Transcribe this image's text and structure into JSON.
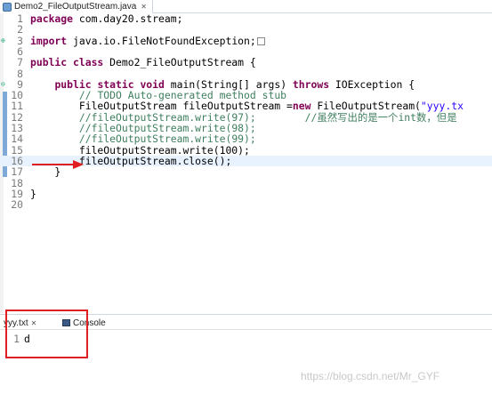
{
  "editor_tab": {
    "title": "Demo2_FileOutputStream.java",
    "close": "✕"
  },
  "lines": [
    {
      "n": "1",
      "parts": [
        [
          "kw",
          "package"
        ],
        [
          "",
          " com.day20.stream;"
        ]
      ]
    },
    {
      "n": "2",
      "parts": []
    },
    {
      "n": "3",
      "marker": "⊕",
      "parts": [
        [
          "kw",
          "import"
        ],
        [
          "",
          " java.io.FileNotFoundException;"
        ]
      ],
      "box": true
    },
    {
      "n": "6",
      "parts": []
    },
    {
      "n": "7",
      "parts": [
        [
          "kw",
          "public class"
        ],
        [
          "",
          " Demo2_FileOutputStream {"
        ]
      ]
    },
    {
      "n": "8",
      "parts": []
    },
    {
      "n": "9",
      "marker": "⊖",
      "parts": [
        [
          "",
          "    "
        ],
        [
          "kw",
          "public static void"
        ],
        [
          "",
          " main(String[] args) "
        ],
        [
          "kw",
          "throws"
        ],
        [
          "",
          " IOException {"
        ]
      ]
    },
    {
      "n": "10",
      "parts": [
        [
          "",
          "        "
        ],
        [
          "cm",
          "// TODO Auto-generated method stub"
        ]
      ]
    },
    {
      "n": "11",
      "parts": [
        [
          "",
          "        FileOutputStream fileOutputStream ="
        ],
        [
          "kw",
          "new"
        ],
        [
          "",
          " FileOutputStream("
        ],
        [
          "str",
          "\"yyy.tx"
        ]
      ]
    },
    {
      "n": "12",
      "parts": [
        [
          "",
          "        "
        ],
        [
          "cm",
          "//fileOutputStream.write(97);        //虽然写出的是一个int数，但是"
        ]
      ]
    },
    {
      "n": "13",
      "parts": [
        [
          "",
          "        "
        ],
        [
          "cm",
          "//fileOutputStream.write(98);"
        ]
      ]
    },
    {
      "n": "14",
      "parts": [
        [
          "",
          "        "
        ],
        [
          "cm",
          "//fileOutputStream.write(99);"
        ]
      ]
    },
    {
      "n": "15",
      "parts": [
        [
          "",
          "        fileOutputStream.write(100);"
        ]
      ]
    },
    {
      "n": "16",
      "parts": [
        [
          "",
          "        fileOutputStream.close();"
        ]
      ],
      "current": true
    },
    {
      "n": "17",
      "parts": [
        [
          "",
          "    }"
        ]
      ]
    },
    {
      "n": "18",
      "parts": []
    },
    {
      "n": "19",
      "parts": [
        [
          "",
          "}"
        ]
      ]
    },
    {
      "n": "20",
      "parts": []
    }
  ],
  "scroll_indicator": "<",
  "panel": {
    "tabs": [
      {
        "label": "yyy.txt",
        "close": "✕"
      },
      {
        "label": "Console"
      }
    ],
    "file_line_number": "1",
    "file_content": "d"
  },
  "annotations": {
    "arrow_color": "#e02020",
    "box_color": "#e02020"
  },
  "watermark": "https://blog.csdn.net/Mr_GYF"
}
